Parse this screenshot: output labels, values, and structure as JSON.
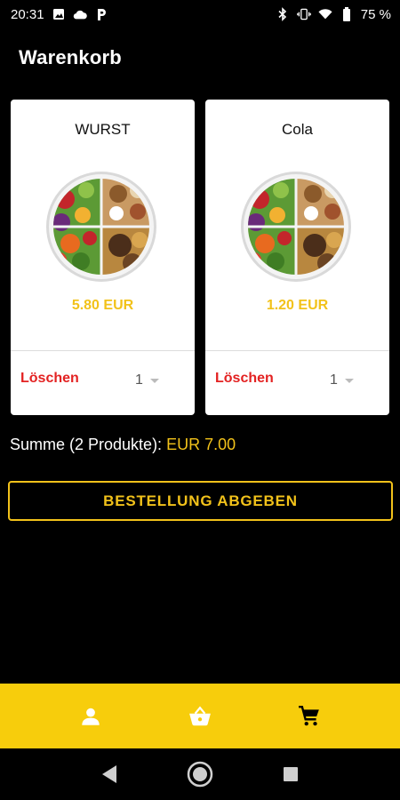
{
  "status_bar": {
    "time": "20:31",
    "battery": "75 %",
    "left_icons": [
      "image-icon",
      "cloud-icon",
      "parking-icon"
    ],
    "right_icons": [
      "bluetooth-icon",
      "vibrate-icon",
      "wifi-icon",
      "battery-icon"
    ]
  },
  "header": {
    "title": "Warenkorb"
  },
  "cart": {
    "items": [
      {
        "name": "WURST",
        "price": "5.80 EUR",
        "delete_label": "Löschen",
        "quantity": "1",
        "image_icon": "food-plate-image"
      },
      {
        "name": "Cola",
        "price": "1.20 EUR",
        "delete_label": "Löschen",
        "quantity": "1",
        "image_icon": "food-plate-image"
      }
    ],
    "summary_label": "Summe (2 Produkte):",
    "summary_total": "EUR 7.00"
  },
  "order_button": {
    "label": "BESTELLUNG ABGEBEN"
  },
  "bottom_nav": {
    "items": [
      "profile-icon",
      "basket-icon",
      "cart-icon"
    ]
  },
  "system_nav": {
    "items": [
      "back-icon",
      "home-icon",
      "recents-icon"
    ]
  },
  "colors": {
    "accent": "#f7cd0c",
    "price": "#f2c21a",
    "danger": "#e32222",
    "background": "#000000",
    "card": "#ffffff"
  }
}
